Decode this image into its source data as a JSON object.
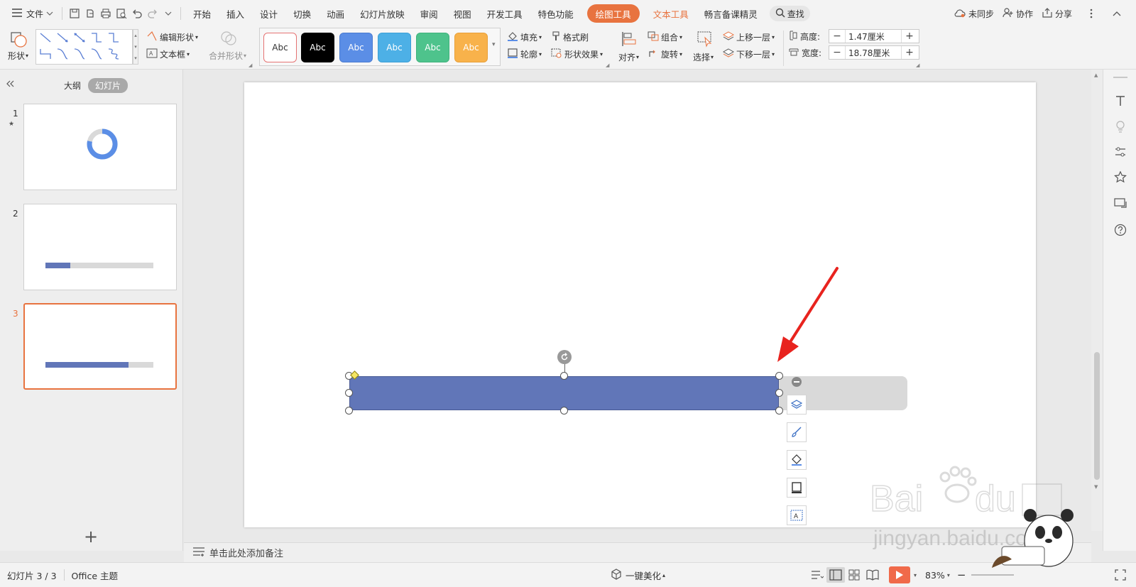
{
  "menubar": {
    "file_label": "文件",
    "tabs": [
      "开始",
      "插入",
      "设计",
      "切换",
      "动画",
      "幻灯片放映",
      "审阅",
      "视图",
      "开发工具",
      "特色功能"
    ],
    "active_tab": "绘图工具",
    "text_tools_tab": "文本工具",
    "extra_tab": "畅言备课精灵",
    "search_label": "查找",
    "sync_label": "未同步",
    "collab_label": "协作",
    "share_label": "分享"
  },
  "ribbon": {
    "shapes_label": "形状",
    "edit_shape_label": "编辑形状",
    "textbox_label": "文本框",
    "merge_shape_label": "合并形状",
    "style_swatches": [
      {
        "label": "Abc",
        "bg": "#ffffff",
        "fg": "#333333",
        "border": "#e57373"
      },
      {
        "label": "Abc",
        "bg": "#000000",
        "fg": "#ffffff",
        "border": "#000000"
      },
      {
        "label": "Abc",
        "bg": "#5b8ee6",
        "fg": "#ffffff",
        "border": "#4a7bd0"
      },
      {
        "label": "Abc",
        "bg": "#4db0e6",
        "fg": "#ffffff",
        "border": "#3d9fd6"
      },
      {
        "label": "Abc",
        "bg": "#4ec38c",
        "fg": "#ffffff",
        "border": "#3fb27c"
      },
      {
        "label": "Abc",
        "bg": "#f8b24b",
        "fg": "#ffffff",
        "border": "#e8a03a"
      }
    ],
    "fill_label": "填充",
    "outline_label": "轮廓",
    "format_painter_label": "格式刷",
    "shape_effects_label": "形状效果",
    "align_label": "对齐",
    "group_label": "组合",
    "rotate_label": "旋转",
    "select_label": "选择",
    "bring_forward_label": "上移一层",
    "send_backward_label": "下移一层",
    "height_label": "高度:",
    "height_value": "1.47厘米",
    "width_label": "宽度:",
    "width_value": "18.78厘米"
  },
  "left_panel": {
    "outline_tab": "大纲",
    "slides_tab": "幻灯片",
    "slides": [
      {
        "number": "1",
        "star": "★"
      },
      {
        "number": "2",
        "progress": 0.23
      },
      {
        "number": "3",
        "progress": 0.77
      }
    ],
    "add_label": "+"
  },
  "slide": {
    "bar_color": "#6176b8",
    "track_color": "#d9d9d9",
    "progress_fraction": 0.77
  },
  "notes": {
    "placeholder": "单击此处添加备注"
  },
  "statusbar": {
    "slide_counter": "幻灯片 3 / 3",
    "theme": "Office 主题",
    "beautify_label": "一键美化",
    "zoom": "83%"
  },
  "colors": {
    "accent": "#e8733f",
    "arrow": "#e8231e"
  }
}
